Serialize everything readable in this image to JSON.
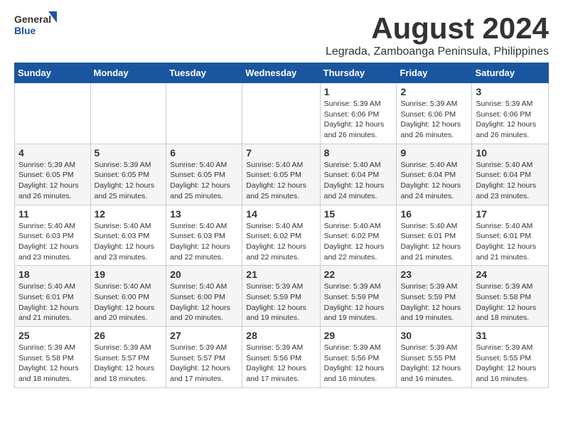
{
  "header": {
    "logo_general": "General",
    "logo_blue": "Blue",
    "main_title": "August 2024",
    "subtitle": "Legrada, Zamboanga Peninsula, Philippines"
  },
  "calendar": {
    "headers": [
      "Sunday",
      "Monday",
      "Tuesday",
      "Wednesday",
      "Thursday",
      "Friday",
      "Saturday"
    ],
    "weeks": [
      [
        {
          "day": "",
          "info": ""
        },
        {
          "day": "",
          "info": ""
        },
        {
          "day": "",
          "info": ""
        },
        {
          "day": "",
          "info": ""
        },
        {
          "day": "1",
          "info": "Sunrise: 5:39 AM\nSunset: 6:06 PM\nDaylight: 12 hours\nand 26 minutes."
        },
        {
          "day": "2",
          "info": "Sunrise: 5:39 AM\nSunset: 6:06 PM\nDaylight: 12 hours\nand 26 minutes."
        },
        {
          "day": "3",
          "info": "Sunrise: 5:39 AM\nSunset: 6:06 PM\nDaylight: 12 hours\nand 26 minutes."
        }
      ],
      [
        {
          "day": "4",
          "info": "Sunrise: 5:39 AM\nSunset: 6:05 PM\nDaylight: 12 hours\nand 26 minutes."
        },
        {
          "day": "5",
          "info": "Sunrise: 5:39 AM\nSunset: 6:05 PM\nDaylight: 12 hours\nand 25 minutes."
        },
        {
          "day": "6",
          "info": "Sunrise: 5:40 AM\nSunset: 6:05 PM\nDaylight: 12 hours\nand 25 minutes."
        },
        {
          "day": "7",
          "info": "Sunrise: 5:40 AM\nSunset: 6:05 PM\nDaylight: 12 hours\nand 25 minutes."
        },
        {
          "day": "8",
          "info": "Sunrise: 5:40 AM\nSunset: 6:04 PM\nDaylight: 12 hours\nand 24 minutes."
        },
        {
          "day": "9",
          "info": "Sunrise: 5:40 AM\nSunset: 6:04 PM\nDaylight: 12 hours\nand 24 minutes."
        },
        {
          "day": "10",
          "info": "Sunrise: 5:40 AM\nSunset: 6:04 PM\nDaylight: 12 hours\nand 23 minutes."
        }
      ],
      [
        {
          "day": "11",
          "info": "Sunrise: 5:40 AM\nSunset: 6:03 PM\nDaylight: 12 hours\nand 23 minutes."
        },
        {
          "day": "12",
          "info": "Sunrise: 5:40 AM\nSunset: 6:03 PM\nDaylight: 12 hours\nand 23 minutes."
        },
        {
          "day": "13",
          "info": "Sunrise: 5:40 AM\nSunset: 6:03 PM\nDaylight: 12 hours\nand 22 minutes."
        },
        {
          "day": "14",
          "info": "Sunrise: 5:40 AM\nSunset: 6:02 PM\nDaylight: 12 hours\nand 22 minutes."
        },
        {
          "day": "15",
          "info": "Sunrise: 5:40 AM\nSunset: 6:02 PM\nDaylight: 12 hours\nand 22 minutes."
        },
        {
          "day": "16",
          "info": "Sunrise: 5:40 AM\nSunset: 6:01 PM\nDaylight: 12 hours\nand 21 minutes."
        },
        {
          "day": "17",
          "info": "Sunrise: 5:40 AM\nSunset: 6:01 PM\nDaylight: 12 hours\nand 21 minutes."
        }
      ],
      [
        {
          "day": "18",
          "info": "Sunrise: 5:40 AM\nSunset: 6:01 PM\nDaylight: 12 hours\nand 21 minutes."
        },
        {
          "day": "19",
          "info": "Sunrise: 5:40 AM\nSunset: 6:00 PM\nDaylight: 12 hours\nand 20 minutes."
        },
        {
          "day": "20",
          "info": "Sunrise: 5:40 AM\nSunset: 6:00 PM\nDaylight: 12 hours\nand 20 minutes."
        },
        {
          "day": "21",
          "info": "Sunrise: 5:39 AM\nSunset: 5:59 PM\nDaylight: 12 hours\nand 19 minutes."
        },
        {
          "day": "22",
          "info": "Sunrise: 5:39 AM\nSunset: 5:59 PM\nDaylight: 12 hours\nand 19 minutes."
        },
        {
          "day": "23",
          "info": "Sunrise: 5:39 AM\nSunset: 5:59 PM\nDaylight: 12 hours\nand 19 minutes."
        },
        {
          "day": "24",
          "info": "Sunrise: 5:39 AM\nSunset: 5:58 PM\nDaylight: 12 hours\nand 18 minutes."
        }
      ],
      [
        {
          "day": "25",
          "info": "Sunrise: 5:39 AM\nSunset: 5:58 PM\nDaylight: 12 hours\nand 18 minutes."
        },
        {
          "day": "26",
          "info": "Sunrise: 5:39 AM\nSunset: 5:57 PM\nDaylight: 12 hours\nand 18 minutes."
        },
        {
          "day": "27",
          "info": "Sunrise: 5:39 AM\nSunset: 5:57 PM\nDaylight: 12 hours\nand 17 minutes."
        },
        {
          "day": "28",
          "info": "Sunrise: 5:39 AM\nSunset: 5:56 PM\nDaylight: 12 hours\nand 17 minutes."
        },
        {
          "day": "29",
          "info": "Sunrise: 5:39 AM\nSunset: 5:56 PM\nDaylight: 12 hours\nand 16 minutes."
        },
        {
          "day": "30",
          "info": "Sunrise: 5:39 AM\nSunset: 5:55 PM\nDaylight: 12 hours\nand 16 minutes."
        },
        {
          "day": "31",
          "info": "Sunrise: 5:39 AM\nSunset: 5:55 PM\nDaylight: 12 hours\nand 16 minutes."
        }
      ]
    ]
  }
}
